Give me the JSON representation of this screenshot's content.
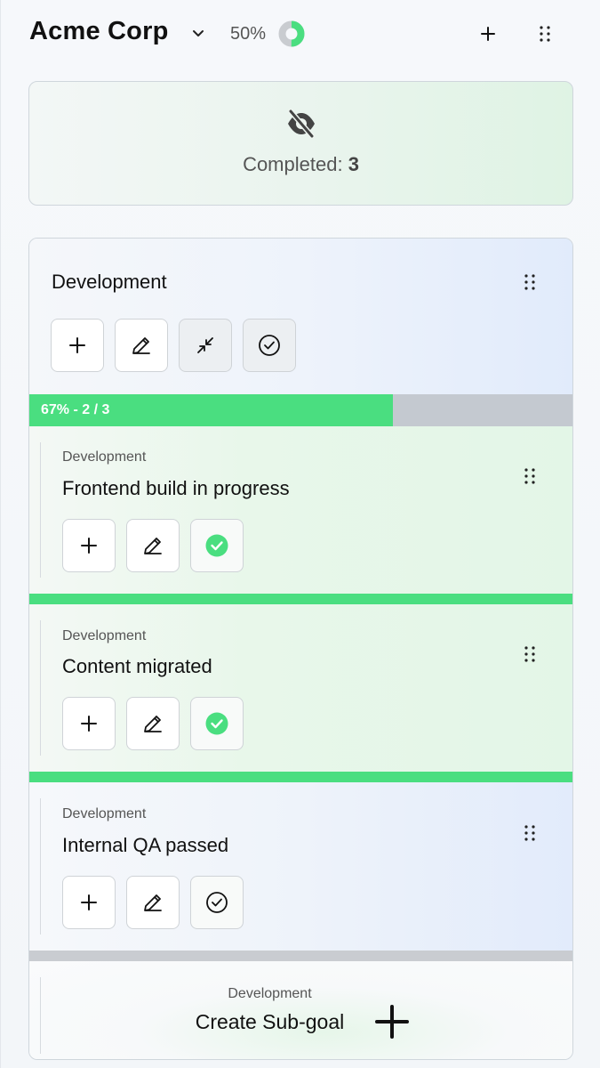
{
  "header": {
    "title": "Acme Corp",
    "percent_label": "50%",
    "percent_value": 0.5,
    "icons": {
      "dropdown": "chevron-down-icon",
      "add": "plus-icon",
      "menu": "drag-dots-icon"
    }
  },
  "completed": {
    "label": "Completed: ",
    "count": "3",
    "icon": "eye-off-icon"
  },
  "goal": {
    "title": "Development",
    "progress_label": "67% - 2 / 3",
    "progress_value": 0.67,
    "actions": [
      "add",
      "edit",
      "collapse",
      "complete"
    ],
    "subgoals": [
      {
        "category": "Development",
        "title": "Frontend build in progress",
        "completed": true
      },
      {
        "category": "Development",
        "title": "Content migrated",
        "completed": true
      },
      {
        "category": "Development",
        "title": "Internal QA passed",
        "completed": false
      }
    ],
    "create": {
      "category": "Development",
      "label": "Create Sub-goal"
    }
  },
  "colors": {
    "accent_green": "#4ade80",
    "track_gray": "#c4c9d0",
    "donut_gray": "#c9ccd0"
  }
}
